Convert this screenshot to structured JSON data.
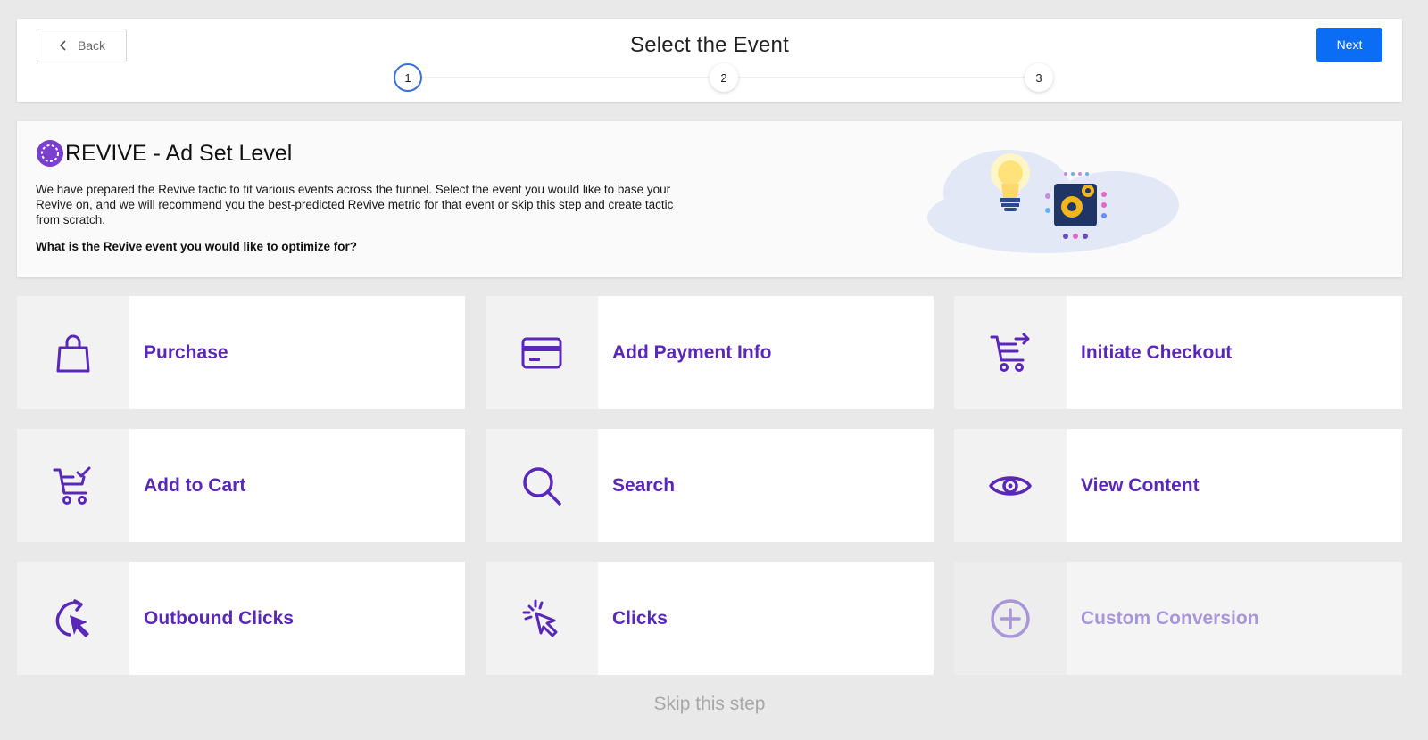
{
  "header": {
    "back_label": "Back",
    "title": "Select the Event",
    "next_label": "Next",
    "steps": [
      "1",
      "2",
      "3"
    ],
    "active_step": 1
  },
  "intro": {
    "title": "REVIVE - Ad Set Level",
    "description": "We have prepared the Revive tactic to fit various events across the funnel. Select the event you would like to base your Revive on, and we will recommend you the best-predicted Revive metric for that event or skip this step and create tactic from scratch.",
    "question": "What is the Revive event you would like to optimize for?"
  },
  "events": [
    {
      "label": "Purchase",
      "icon": "shopping-bag-icon"
    },
    {
      "label": "Add Payment Info",
      "icon": "credit-card-icon"
    },
    {
      "label": "Initiate Checkout",
      "icon": "cart-arrow-icon"
    },
    {
      "label": "Add to Cart",
      "icon": "cart-check-icon"
    },
    {
      "label": "Search",
      "icon": "magnifier-icon"
    },
    {
      "label": "View Content",
      "icon": "eye-icon"
    },
    {
      "label": "Outbound Clicks",
      "icon": "redirect-cursor-icon"
    },
    {
      "label": "Clicks",
      "icon": "click-cursor-icon"
    },
    {
      "label": "Custom Conversion",
      "icon": "plus-circle-icon",
      "disabled": true
    }
  ],
  "skip_label": "Skip this step",
  "colors": {
    "accent": "#5a28b8",
    "primary_button": "#0b6cf5",
    "disabled_label": "#a896d8"
  }
}
